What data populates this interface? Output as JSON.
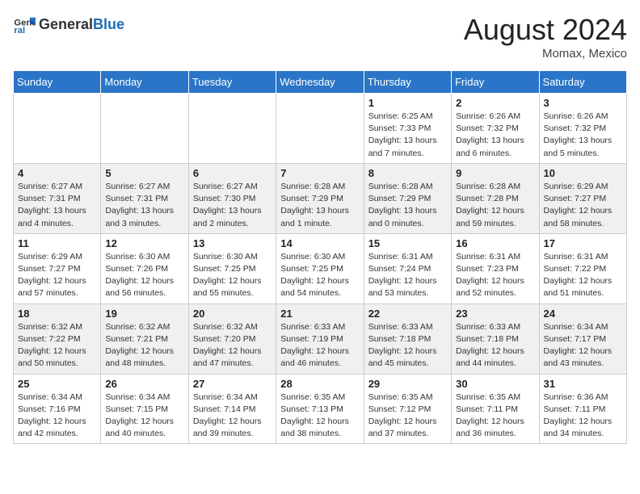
{
  "header": {
    "logo_general": "General",
    "logo_blue": "Blue",
    "month_year": "August 2024",
    "location": "Momax, Mexico"
  },
  "days_of_week": [
    "Sunday",
    "Monday",
    "Tuesday",
    "Wednesday",
    "Thursday",
    "Friday",
    "Saturday"
  ],
  "weeks": [
    [
      {
        "day": "",
        "info": ""
      },
      {
        "day": "",
        "info": ""
      },
      {
        "day": "",
        "info": ""
      },
      {
        "day": "",
        "info": ""
      },
      {
        "day": "1",
        "info": "Sunrise: 6:25 AM\nSunset: 7:33 PM\nDaylight: 13 hours\nand 7 minutes."
      },
      {
        "day": "2",
        "info": "Sunrise: 6:26 AM\nSunset: 7:32 PM\nDaylight: 13 hours\nand 6 minutes."
      },
      {
        "day": "3",
        "info": "Sunrise: 6:26 AM\nSunset: 7:32 PM\nDaylight: 13 hours\nand 5 minutes."
      }
    ],
    [
      {
        "day": "4",
        "info": "Sunrise: 6:27 AM\nSunset: 7:31 PM\nDaylight: 13 hours\nand 4 minutes."
      },
      {
        "day": "5",
        "info": "Sunrise: 6:27 AM\nSunset: 7:31 PM\nDaylight: 13 hours\nand 3 minutes."
      },
      {
        "day": "6",
        "info": "Sunrise: 6:27 AM\nSunset: 7:30 PM\nDaylight: 13 hours\nand 2 minutes."
      },
      {
        "day": "7",
        "info": "Sunrise: 6:28 AM\nSunset: 7:29 PM\nDaylight: 13 hours\nand 1 minute."
      },
      {
        "day": "8",
        "info": "Sunrise: 6:28 AM\nSunset: 7:29 PM\nDaylight: 13 hours\nand 0 minutes."
      },
      {
        "day": "9",
        "info": "Sunrise: 6:28 AM\nSunset: 7:28 PM\nDaylight: 12 hours\nand 59 minutes."
      },
      {
        "day": "10",
        "info": "Sunrise: 6:29 AM\nSunset: 7:27 PM\nDaylight: 12 hours\nand 58 minutes."
      }
    ],
    [
      {
        "day": "11",
        "info": "Sunrise: 6:29 AM\nSunset: 7:27 PM\nDaylight: 12 hours\nand 57 minutes."
      },
      {
        "day": "12",
        "info": "Sunrise: 6:30 AM\nSunset: 7:26 PM\nDaylight: 12 hours\nand 56 minutes."
      },
      {
        "day": "13",
        "info": "Sunrise: 6:30 AM\nSunset: 7:25 PM\nDaylight: 12 hours\nand 55 minutes."
      },
      {
        "day": "14",
        "info": "Sunrise: 6:30 AM\nSunset: 7:25 PM\nDaylight: 12 hours\nand 54 minutes."
      },
      {
        "day": "15",
        "info": "Sunrise: 6:31 AM\nSunset: 7:24 PM\nDaylight: 12 hours\nand 53 minutes."
      },
      {
        "day": "16",
        "info": "Sunrise: 6:31 AM\nSunset: 7:23 PM\nDaylight: 12 hours\nand 52 minutes."
      },
      {
        "day": "17",
        "info": "Sunrise: 6:31 AM\nSunset: 7:22 PM\nDaylight: 12 hours\nand 51 minutes."
      }
    ],
    [
      {
        "day": "18",
        "info": "Sunrise: 6:32 AM\nSunset: 7:22 PM\nDaylight: 12 hours\nand 50 minutes."
      },
      {
        "day": "19",
        "info": "Sunrise: 6:32 AM\nSunset: 7:21 PM\nDaylight: 12 hours\nand 48 minutes."
      },
      {
        "day": "20",
        "info": "Sunrise: 6:32 AM\nSunset: 7:20 PM\nDaylight: 12 hours\nand 47 minutes."
      },
      {
        "day": "21",
        "info": "Sunrise: 6:33 AM\nSunset: 7:19 PM\nDaylight: 12 hours\nand 46 minutes."
      },
      {
        "day": "22",
        "info": "Sunrise: 6:33 AM\nSunset: 7:18 PM\nDaylight: 12 hours\nand 45 minutes."
      },
      {
        "day": "23",
        "info": "Sunrise: 6:33 AM\nSunset: 7:18 PM\nDaylight: 12 hours\nand 44 minutes."
      },
      {
        "day": "24",
        "info": "Sunrise: 6:34 AM\nSunset: 7:17 PM\nDaylight: 12 hours\nand 43 minutes."
      }
    ],
    [
      {
        "day": "25",
        "info": "Sunrise: 6:34 AM\nSunset: 7:16 PM\nDaylight: 12 hours\nand 42 minutes."
      },
      {
        "day": "26",
        "info": "Sunrise: 6:34 AM\nSunset: 7:15 PM\nDaylight: 12 hours\nand 40 minutes."
      },
      {
        "day": "27",
        "info": "Sunrise: 6:34 AM\nSunset: 7:14 PM\nDaylight: 12 hours\nand 39 minutes."
      },
      {
        "day": "28",
        "info": "Sunrise: 6:35 AM\nSunset: 7:13 PM\nDaylight: 12 hours\nand 38 minutes."
      },
      {
        "day": "29",
        "info": "Sunrise: 6:35 AM\nSunset: 7:12 PM\nDaylight: 12 hours\nand 37 minutes."
      },
      {
        "day": "30",
        "info": "Sunrise: 6:35 AM\nSunset: 7:11 PM\nDaylight: 12 hours\nand 36 minutes."
      },
      {
        "day": "31",
        "info": "Sunrise: 6:36 AM\nSunset: 7:11 PM\nDaylight: 12 hours\nand 34 minutes."
      }
    ]
  ]
}
